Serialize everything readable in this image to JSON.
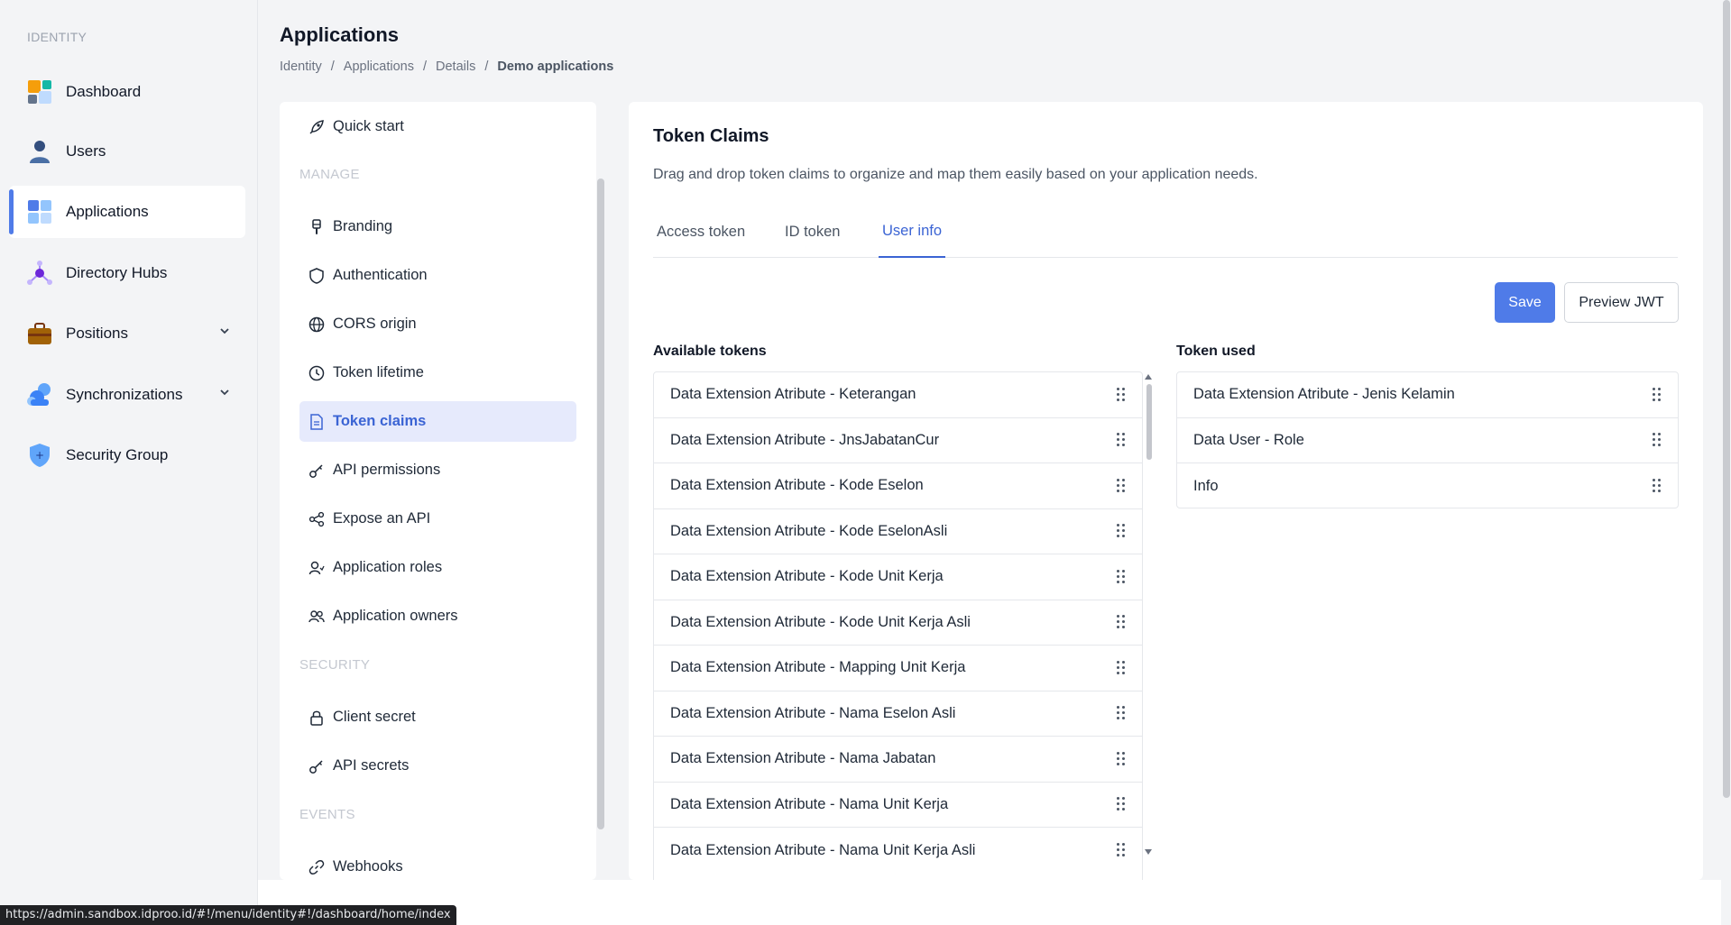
{
  "nav": {
    "section": "IDENTITY",
    "items": [
      {
        "label": "Dashboard",
        "icon": "dashboard-icon"
      },
      {
        "label": "Users",
        "icon": "user-icon"
      },
      {
        "label": "Applications",
        "icon": "applications-icon"
      },
      {
        "label": "Directory Hubs",
        "icon": "hub-icon"
      },
      {
        "label": "Positions",
        "icon": "briefcase-icon"
      },
      {
        "label": "Synchronizations",
        "icon": "cloud-sync-icon"
      },
      {
        "label": "Security Group",
        "icon": "shield-icon"
      }
    ]
  },
  "header": {
    "title": "Applications",
    "breadcrumb": [
      "Identity",
      "Applications",
      "Details",
      "Demo applications"
    ]
  },
  "menu": {
    "items": {
      "quick_start": "Quick start",
      "branding": "Branding",
      "authentication": "Authentication",
      "cors": "CORS origin",
      "token_lifetime": "Token lifetime",
      "token_claims": "Token claims",
      "api_permissions": "API permissions",
      "expose_api": "Expose an API",
      "app_roles": "Application roles",
      "app_owners": "Application owners",
      "client_secret": "Client secret",
      "api_secrets": "API secrets",
      "webhooks": "Webhooks"
    },
    "groups": {
      "manage": "MANAGE",
      "security": "SECURITY",
      "events": "EVENTS"
    }
  },
  "main": {
    "title": "Token Claims",
    "description": "Drag and drop token claims to organize and map them easily based on your application needs.",
    "tabs": [
      "Access token",
      "ID token",
      "User info"
    ],
    "active_tab": "User info",
    "save_label": "Save",
    "preview_label": "Preview JWT",
    "available_title": "Available tokens",
    "used_title": "Token used",
    "available": [
      "Data Extension Atribute - Keterangan",
      "Data Extension Atribute - JnsJabatanCur",
      "Data Extension Atribute - Kode Eselon",
      "Data Extension Atribute - Kode EselonAsli",
      "Data Extension Atribute - Kode Unit Kerja",
      "Data Extension Atribute - Kode Unit Kerja Asli",
      "Data Extension Atribute - Mapping Unit Kerja",
      "Data Extension Atribute - Nama Eselon Asli",
      "Data Extension Atribute - Nama Jabatan",
      "Data Extension Atribute - Nama Unit Kerja",
      "Data Extension Atribute - Nama Unit Kerja Asli"
    ],
    "used": [
      "Data Extension Atribute - Jenis Kelamin",
      "Data User - Role",
      "Info"
    ]
  },
  "status_url": "https://admin.sandbox.idproo.id/#!/menu/identity#!/dashboard/home/index",
  "colors": {
    "accent": "#4f7be8",
    "active_menu_bg": "#e6eafc",
    "active_text": "#3b64d4"
  }
}
